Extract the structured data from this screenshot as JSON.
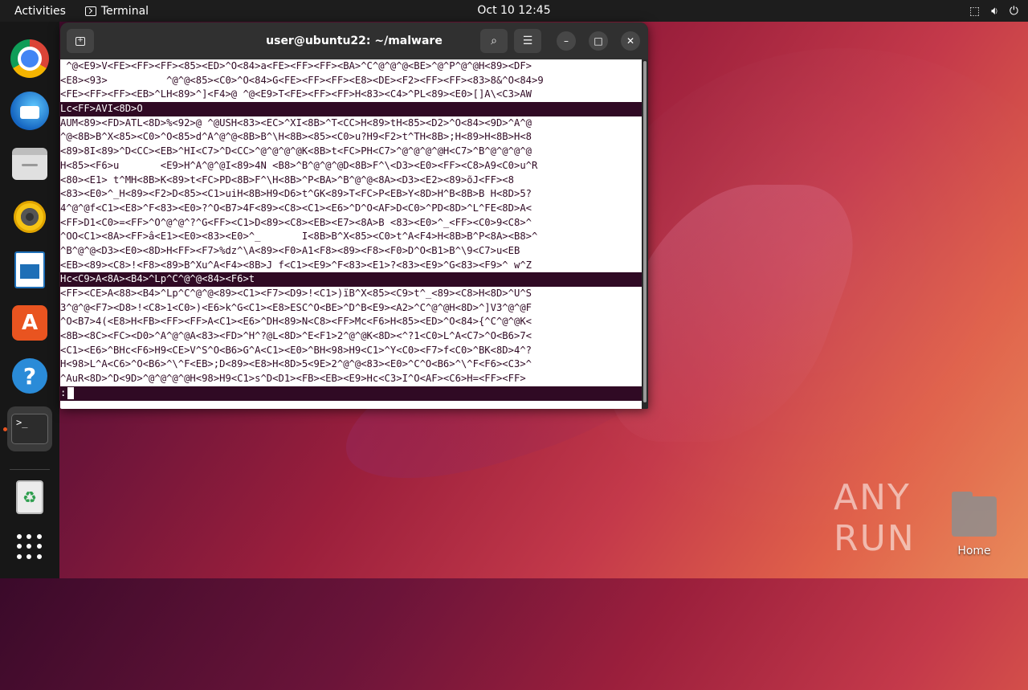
{
  "topbar": {
    "activities": "Activities",
    "app_name": "Terminal",
    "clock": "Oct 10  12:45",
    "tray_icons": [
      "network-icon",
      "volume-icon",
      "power-icon"
    ]
  },
  "dock": {
    "items": [
      {
        "name": "chrome",
        "label": "Google Chrome"
      },
      {
        "name": "thunderbird",
        "label": "Thunderbird"
      },
      {
        "name": "files",
        "label": "Files"
      },
      {
        "name": "rhythmbox",
        "label": "Rhythmbox"
      },
      {
        "name": "writer",
        "label": "LibreOffice Writer"
      },
      {
        "name": "software",
        "label": "Ubuntu Software"
      },
      {
        "name": "help",
        "label": "Help"
      },
      {
        "name": "terminal",
        "label": "Terminal",
        "running": true
      },
      {
        "name": "trash",
        "label": "Trash"
      },
      {
        "name": "app-grid",
        "label": "Show Applications"
      }
    ],
    "terminal_glyph": ">_"
  },
  "window": {
    "title": "user@ubuntu22: ~/malware",
    "accent": "#300a24"
  },
  "terminal": {
    "lines": [
      " ^@<E9>V<FE><FF><FF><85><ED>^O<84>a<FE><FF><FF><BA>^C^@^@^@<BE>^@^P^@^@H<89><DF>",
      "<E8><93>          ^@^@<85><C0>^O<84>G<FE><FF><FF><E8><DE><F2><FF><FF><83>8&^O<84>9",
      "<FE><FF><FF><EB>^LH<89>^]<F4>@ ^@<E9>T<FE><FF><FF>H<83><C4>^PL<89><E0>[]A\\<C3>AW",
      "Lc<FF>AVI<8D>O",
      "AUM<89><FD>ATL<8D>%<92>@ ^@USH<83><EC>^XI<8B>^T<CC>H<89>tH<85><D2>^O<84><9D>^A^@",
      "^@<8B>B^X<85><C0>^O<85>d^A^@^@<8B>B^\\H<8B><85><C0>u?H9<F2>t^TH<8B>;H<89>H<8B>H<8",
      "<89>8I<89>^D<CC><EB>^HI<C7>^D<CC>^@^@^@^@K<8B>t<FC>PH<C7>^@^@^@^@H<C7>^B^@^@^@^@",
      "H<85><F6>u       <E9>H^A^@^@I<89>4N <B8>^B^@^@^@D<8B>F^\\<D3><E0><FF><C8>A9<C0>u^R",
      "<80><E1> t^MH<8B>K<89>t<FC>PD<8B>F^\\H<8B>^P<BA>^B^@^@<8A><D3><E2><89>õJ<FF><8",
      "<83><E0>^_H<89><F2>D<85><C1>uiH<8B>H9<D6>t^GK<89>T<FC>P<EB>Y<8D>H^B<8B>B H<8D>5?",
      "4^@^@f<C1><E8>^F<83><E0>?^O<B7>4F<89><C8><C1><E6>^D^O<AF>D<C0>^PD<8D>^L^FE<8D>A<",
      "<FF>D1<C0>=<FF>^O^@^@^?^G<FF><C1>D<89><C8><EB><E7><8A>B <83><E0>^_<FF><C0>9<C8>^",
      "^OO<C1><8A><FF>â<E1><E0><83><E0>^_       I<8B>B^X<85><C0>t^A<F4>H<8B>B^P<8A><B8>^",
      "^B^@^@<D3><E0><8D>H<FF><F7>%dz^\\A<89><F0>A1<F8><89><F8><F0>D^O<B1>B^\\9<C7>u<EB",
      "<EB><89><C8>!<F8><89>B^Xu^A<F4><8B>J f<C1><E9>^F<83><E1>?<83><E9>^G<83><F9>^ w^Z",
      "Hc<C9>A<8A><B4>^Lp^C^@^@<84><F6>t",
      "<FF><CE>A<88><B4>^Lp^C^@^@<89><C1><F7><D9>!<C1>)ïB^X<85><C9>t^_<89><C8>H<8D>^U^S",
      "3^@^@<F7><D8>!<C8>1<C0>)<E6>k^G<C1><E8>ESC^O<BE>^D^B<E9><A2>^C^@^@H<8D>^]V3^@^@F",
      "^O<B7>4(<E8>H<FB><FF><FF>A<C1><E6>^DH<89>N<C8><FF>Mc<F6>H<85><ED>^O<84>{^C^@^@K<",
      "<8B><8C><FC><D0>^A^@^@A<83><FD>^H^?@L<8D>^E<F1>2^@^@K<8D><^?1<C0>L^A<C7>^O<B6>7<",
      "<C1><E6>^BHc<F6>H9<CE>V^S^O<B6>G^A<C1><E0>^BH<98>H9<C1>^Y<C0><F7>f<C0>^BK<8D>4^?",
      "H<98>L^A<C6>^O<B6>^\\^F<EB>;D<89><E8>H<8D>5<9E>2^@^@<83><E0>^C^O<B6>^\\^F<F6><C3>^",
      "^AuR<8D>^D<9D>^@^@^@^@H<98>H9<C1>s^D<D1><FB><EB><E9>Hc<C3>I^O<AF><C6>H=<FF><FF>"
    ],
    "dark_line_indices": [
      3,
      15
    ],
    "prompt": ":"
  },
  "desktop": {
    "home_label": "Home",
    "watermark": "ANY RUN"
  }
}
